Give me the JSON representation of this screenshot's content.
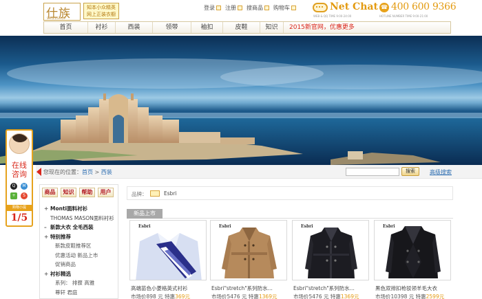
{
  "header": {
    "logo_text": "仕族",
    "logo_subtext": "SHIZUSHOP",
    "slogan_line1": "知本小众精英",
    "slogan_line2": "网上正装衣橱",
    "top_links": [
      "登录",
      "注册",
      "搜商品",
      "购物车"
    ],
    "netchat": {
      "title": "Net Chat",
      "subtitle": "WEB & QQ  TIME 9:00-24:00"
    },
    "hotline": {
      "number": "400 600 9366",
      "subtitle": "HOTLINE NUMBER  TIME 9:00-21:00"
    }
  },
  "nav": {
    "items": [
      "首页",
      "衬衫",
      "西装",
      "领带",
      "袖扣",
      "皮鞋",
      "知识"
    ],
    "promo": "2015新官网，优惠更多"
  },
  "side_chat": {
    "line1": "在线",
    "line2": "咨询",
    "cart_label": "购物小提",
    "cart_count": "1/5"
  },
  "breadcrumb": {
    "prefix": "您现在的位置：",
    "home": "首页",
    "separator": " > ",
    "current": "西装",
    "search_button": "搜索",
    "advanced_search": "高级搜索"
  },
  "sidebar": {
    "tabs": [
      "商品",
      "知识",
      "帮助",
      "用户"
    ],
    "rows": [
      {
        "mark": "+",
        "text": "Monti面料衬衫",
        "style": "head"
      },
      {
        "mark": "",
        "text": "THOMAS MASON面料衬衫",
        "style": "plain"
      },
      {
        "mark": "–",
        "text": "新款大衣 全毛西装",
        "style": "head"
      },
      {
        "mark": "+",
        "text": "特别推荐",
        "style": "head"
      },
      {
        "mark": "",
        "text": "新款皮鞋推荐区",
        "style": "sub"
      },
      {
        "mark": "",
        "text": "优惠活动  新品上市",
        "style": "sub"
      },
      {
        "mark": "",
        "text": "促销商品",
        "style": "sub"
      },
      {
        "mark": "+",
        "text": "衬衫精选",
        "style": "head"
      },
      {
        "mark": "",
        "text": "系列：  排骤  高雅",
        "style": "sub"
      },
      {
        "mark": "",
        "text": "尊轩  君庭",
        "style": "sub"
      }
    ]
  },
  "main": {
    "brand_label": "品牌：",
    "brand_name": "Esbri",
    "section_title": "新品上市",
    "products": [
      {
        "brand": "Esbri",
        "name": "高端苗色小菱格英式衬衫",
        "list_label": "市场价",
        "list_price": "898",
        "unit": "元",
        "sale_label": "特惠",
        "sale_price": "369元",
        "item": "shirt"
      },
      {
        "brand": "Esbri",
        "name": "Esbri\"stretch\"系列防水...",
        "list_label": "市场价",
        "list_price": "5476",
        "unit": "元",
        "sale_label": "特惠",
        "sale_price": "1369元",
        "item": "trench-tan"
      },
      {
        "brand": "Esbri",
        "name": "Esbri\"stretch\"系列防水...",
        "list_label": "市场价",
        "list_price": "5476",
        "unit": "元",
        "sale_label": "特惠",
        "sale_price": "1369元",
        "item": "trench-black"
      },
      {
        "brand": "Esbri",
        "name": "黑色双排扣枪驳领羊毛大衣",
        "list_label": "市场价",
        "list_price": "10398",
        "unit": "元",
        "sale_label": "特惠",
        "sale_price": "2599元",
        "item": "coat-black"
      }
    ]
  },
  "colors": {
    "accent": "#e39a0f",
    "promo_red": "#d9261c",
    "link_blue": "#2f6fb2"
  }
}
